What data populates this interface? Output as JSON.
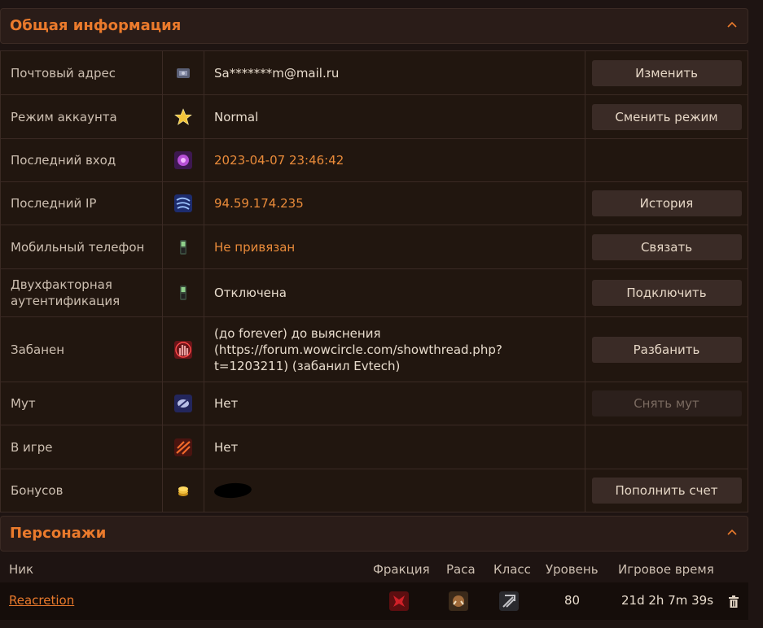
{
  "general": {
    "title": "Общая информация",
    "rows": [
      {
        "label": "Почтовый адрес",
        "icon": "mailbox-icon",
        "value": "Sa*******m@mail.ru",
        "value_color": "normal",
        "action": "Изменить",
        "action_enabled": true
      },
      {
        "label": "Режим аккаунта",
        "icon": "star-icon",
        "value": "Normal",
        "value_color": "normal",
        "action": "Сменить режим",
        "action_enabled": true
      },
      {
        "label": "Последний вход",
        "icon": "portal-icon",
        "value": "2023-04-07 23:46:42",
        "value_color": "orange",
        "action": "",
        "action_enabled": false
      },
      {
        "label": "Последний IP",
        "icon": "network-icon",
        "value": "94.59.174.235",
        "value_color": "orange",
        "action": "История",
        "action_enabled": true
      },
      {
        "label": "Мобильный телефон",
        "icon": "phone-icon",
        "value": "Не привязан",
        "value_color": "orange",
        "action": "Связать",
        "action_enabled": true
      },
      {
        "label": "Двухфакторная аутентификация",
        "icon": "phone-icon",
        "value": "Отключена",
        "value_color": "normal",
        "action": "Подключить",
        "action_enabled": true
      },
      {
        "label": "Забанен",
        "icon": "ban-hand-icon",
        "value": "(до forever) до выяснения (https://forum.wowcircle.com/showthread.php?t=1203211) (забанил Evtech)",
        "value_color": "normal",
        "action": "Разбанить",
        "action_enabled": true
      },
      {
        "label": "Мут",
        "icon": "mute-icon",
        "value": "Нет",
        "value_color": "normal",
        "action": "Снять мут",
        "action_enabled": false
      },
      {
        "label": "В игре",
        "icon": "in-game-icon",
        "value": "Нет",
        "value_color": "normal",
        "action": "",
        "action_enabled": false
      },
      {
        "label": "Бонусов",
        "icon": "coins-icon",
        "value": "",
        "value_color": "redacted",
        "action": "Пополнить счет",
        "action_enabled": true
      }
    ]
  },
  "characters": {
    "title": "Персонажи",
    "columns": {
      "name": "Ник",
      "faction": "Фракция",
      "race": "Раса",
      "class": "Класс",
      "level": "Уровень",
      "playtime": "Игровое время"
    },
    "rows": [
      {
        "name": "Reacretion",
        "faction_icon": "horde-icon",
        "race_icon": "orc-icon",
        "class_icon": "warrior-icon",
        "level": "80",
        "playtime": "21d 2h 7m 39s",
        "delete_icon": "trash-icon"
      }
    ]
  },
  "colors": {
    "accent": "#ea7a2c",
    "panel": "#2a1c18",
    "border": "#3b2a24"
  }
}
